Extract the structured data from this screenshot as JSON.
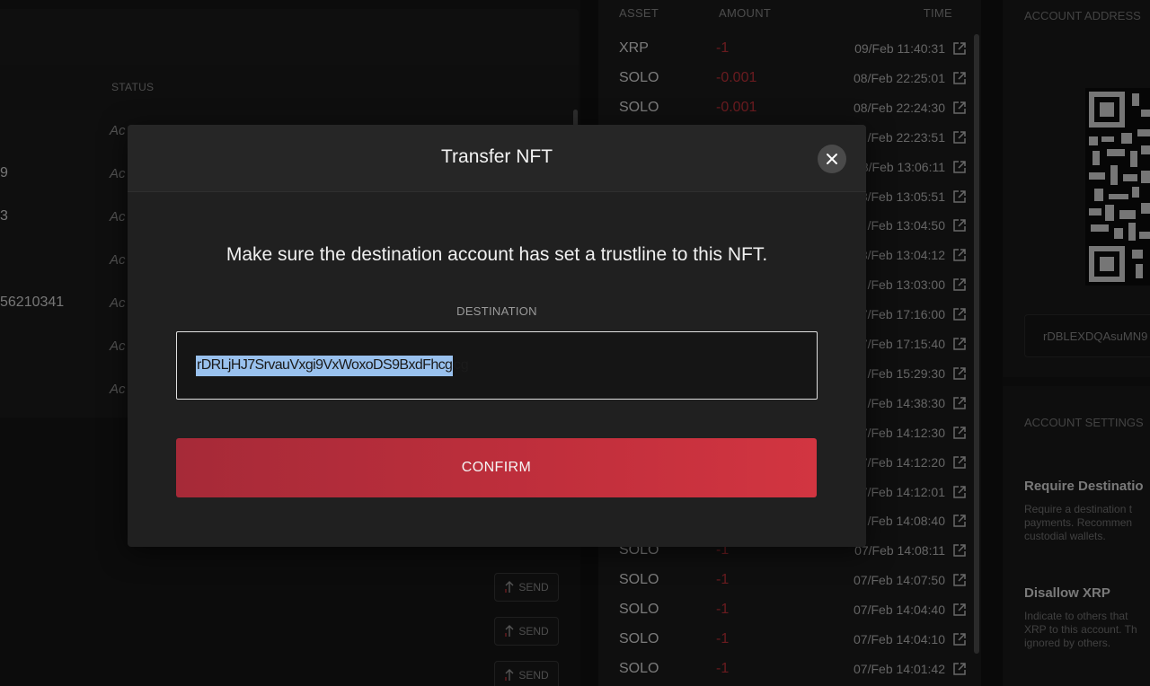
{
  "left_panel": {
    "status_header": "STATUS",
    "rows": [
      {
        "id": "",
        "status": "Ac"
      },
      {
        "id": "9",
        "status": "Ac"
      },
      {
        "id": "3",
        "status": "Ac"
      },
      {
        "id": "",
        "status": "Ac"
      },
      {
        "id": "56210341",
        "status": "Ac"
      },
      {
        "id": "",
        "status": "Ac"
      },
      {
        "id": "",
        "status": "Ac"
      }
    ],
    "send_label": "SEND"
  },
  "transactions": {
    "headers": {
      "asset": "ASSET",
      "amount": "AMOUNT",
      "time": "TIME"
    },
    "rows": [
      {
        "asset": "XRP",
        "amount": "-1",
        "time": "09/Feb 11:40:31"
      },
      {
        "asset": "SOLO",
        "amount": "-0.001",
        "time": "08/Feb 22:25:01"
      },
      {
        "asset": "SOLO",
        "amount": "-0.001",
        "time": "08/Feb 22:24:30"
      },
      {
        "asset": "",
        "amount": "",
        "time": "/Feb 22:23:51"
      },
      {
        "asset": "",
        "amount": "",
        "time": "8/Feb 13:06:11"
      },
      {
        "asset": "",
        "amount": "",
        "time": "8/Feb 13:05:51"
      },
      {
        "asset": "",
        "amount": "",
        "time": "/Feb 13:04:50"
      },
      {
        "asset": "",
        "amount": "",
        "time": "8/Feb 13:04:12"
      },
      {
        "asset": "",
        "amount": "",
        "time": "/Feb 13:03:00"
      },
      {
        "asset": "",
        "amount": "",
        "time": "7/Feb 17:16:00"
      },
      {
        "asset": "",
        "amount": "",
        "time": "7/Feb 17:15:40"
      },
      {
        "asset": "",
        "amount": "",
        "time": "/Feb 15:29:30"
      },
      {
        "asset": "",
        "amount": "",
        "time": "/Feb 14:38:30"
      },
      {
        "asset": "",
        "amount": "",
        "time": "7/Feb 14:12:30"
      },
      {
        "asset": "",
        "amount": "",
        "time": "7/Feb 14:12:20"
      },
      {
        "asset": "",
        "amount": "",
        "time": "07/Feb 14:12:01"
      },
      {
        "asset": "",
        "amount": "",
        "time": "/Feb 14:08:40"
      },
      {
        "asset": "SOLO",
        "amount": "-1",
        "time": "07/Feb 14:08:11"
      },
      {
        "asset": "SOLO",
        "amount": "-1",
        "time": "07/Feb 14:07:50"
      },
      {
        "asset": "SOLO",
        "amount": "-1",
        "time": "07/Feb 14:04:40"
      },
      {
        "asset": "SOLO",
        "amount": "-1",
        "time": "07/Feb 14:04:10"
      },
      {
        "asset": "SOLO",
        "amount": "-1",
        "time": "07/Feb 14:01:42"
      }
    ]
  },
  "right_panel": {
    "account_address_title": "ACCOUNT ADDRESS",
    "address_short": "rDBLEXDQAsuMN9",
    "account_settings_title": "ACCOUNT SETTINGS",
    "settings": [
      {
        "title": "Require Destinatio",
        "desc": [
          "Require a destination t",
          "payments. Recommen",
          "custodial wallets."
        ]
      },
      {
        "title": "Disallow XRP",
        "desc": [
          "Indicate to others that",
          "XRP to this account. Th",
          "ignored by others."
        ]
      }
    ]
  },
  "modal": {
    "title": "Transfer NFT",
    "message": "Make sure the destination account has set a trustline to this NFT.",
    "destination_label": "DESTINATION",
    "destination_value": "rDRLjHJ7SrvauVxgi9VxWoxoDS9BxdFhcg",
    "confirm_label": "CONFIRM"
  },
  "colors": {
    "accent_red": "#c12f3c",
    "negative_amount": "#c0323a",
    "selection": "#99c1ee"
  },
  "icons": {
    "close": "close-icon",
    "external_link": "external-link-icon",
    "send": "send-arrow-icon"
  }
}
